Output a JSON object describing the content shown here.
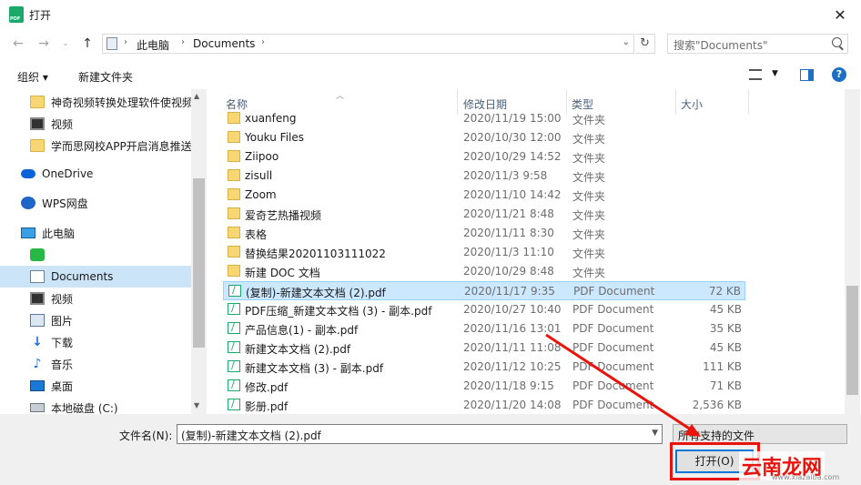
{
  "window": {
    "title": "打开"
  },
  "address": {
    "crumbs": [
      "此电脑",
      "Documents"
    ]
  },
  "search": {
    "placeholder": "搜索\"Documents\""
  },
  "toolbar": {
    "organize": "组织 ▾",
    "new_folder": "新建文件夹"
  },
  "sidebar": {
    "items": [
      {
        "label": "神奇视频转换处理软件使视频",
        "icon": "folder-icon"
      },
      {
        "label": "视频",
        "icon": "video-icon"
      },
      {
        "label": "学而思网校APP开启消息推送",
        "icon": "folder-icon"
      },
      {
        "label": "OneDrive",
        "icon": "cloud-icon"
      },
      {
        "label": "WPS网盘",
        "icon": "wps-icon"
      },
      {
        "label": "此电脑",
        "icon": "pc-icon"
      },
      {
        "label": "",
        "icon": "green-app-icon"
      },
      {
        "label": "Documents",
        "icon": "document-icon",
        "selected": true
      },
      {
        "label": "视频",
        "icon": "video-icon"
      },
      {
        "label": "图片",
        "icon": "picture-icon"
      },
      {
        "label": "下载",
        "icon": "download-icon"
      },
      {
        "label": "音乐",
        "icon": "music-icon"
      },
      {
        "label": "桌面",
        "icon": "desktop-icon"
      },
      {
        "label": "本地磁盘 (C:)",
        "icon": "drive-icon"
      }
    ]
  },
  "columns": [
    "名称",
    "修改日期",
    "类型",
    "大小"
  ],
  "files": [
    {
      "name": "xuanfeng",
      "date": "2020/11/19 15:00",
      "type": "文件夹",
      "size": "",
      "kind": "folder"
    },
    {
      "name": "Youku Files",
      "date": "2020/10/30 12:00",
      "type": "文件夹",
      "size": "",
      "kind": "folder"
    },
    {
      "name": "Ziipoo",
      "date": "2020/10/29 14:52",
      "type": "文件夹",
      "size": "",
      "kind": "folder"
    },
    {
      "name": "zisull",
      "date": "2020/11/3 9:58",
      "type": "文件夹",
      "size": "",
      "kind": "folder"
    },
    {
      "name": "Zoom",
      "date": "2020/11/10 14:42",
      "type": "文件夹",
      "size": "",
      "kind": "folder"
    },
    {
      "name": "爱奇艺热播视频",
      "date": "2020/11/21 8:48",
      "type": "文件夹",
      "size": "",
      "kind": "folder"
    },
    {
      "name": "表格",
      "date": "2020/11/11 8:30",
      "type": "文件夹",
      "size": "",
      "kind": "folder"
    },
    {
      "name": "替换结果20201103111022",
      "date": "2020/11/3 11:10",
      "type": "文件夹",
      "size": "",
      "kind": "folder"
    },
    {
      "name": "新建 DOC 文档",
      "date": "2020/10/29 8:48",
      "type": "文件夹",
      "size": "",
      "kind": "folder"
    },
    {
      "name": "(复制)-新建文本文档 (2).pdf",
      "date": "2020/11/17 9:35",
      "type": "PDF Document",
      "size": "72 KB",
      "kind": "pdf",
      "selected": true
    },
    {
      "name": "PDF压缩_新建文本文档 (3) - 副本.pdf",
      "date": "2020/10/27 10:40",
      "type": "PDF Document",
      "size": "45 KB",
      "kind": "pdf"
    },
    {
      "name": "产品信息(1) - 副本.pdf",
      "date": "2020/11/16 13:01",
      "type": "PDF Document",
      "size": "35 KB",
      "kind": "pdf"
    },
    {
      "name": "新建文本文档 (2).pdf",
      "date": "2020/11/11 11:08",
      "type": "PDF Document",
      "size": "45 KB",
      "kind": "pdf"
    },
    {
      "name": "新建文本文档 (3) - 副本.pdf",
      "date": "2020/11/12 10:25",
      "type": "PDF Document",
      "size": "111 KB",
      "kind": "pdf"
    },
    {
      "name": "修改.pdf",
      "date": "2020/11/18 9:15",
      "type": "PDF Document",
      "size": "71 KB",
      "kind": "pdf"
    },
    {
      "name": "影册.pdf",
      "date": "2020/11/20 14:08",
      "type": "PDF Document",
      "size": "2,536 KB",
      "kind": "pdf"
    }
  ],
  "bottom": {
    "filename_label": "文件名(N):",
    "filename_value": "(复制)-新建文本文档 (2).pdf",
    "filetype_value": "所有支持的文件",
    "open_label": "打开(O)"
  },
  "watermark": {
    "text": "云南龙网",
    "sub": "www.xiazaiba.com"
  },
  "colors": {
    "accent": "#0078d7",
    "highlight_red": "#e8140c",
    "selection": "#cce8ff"
  }
}
